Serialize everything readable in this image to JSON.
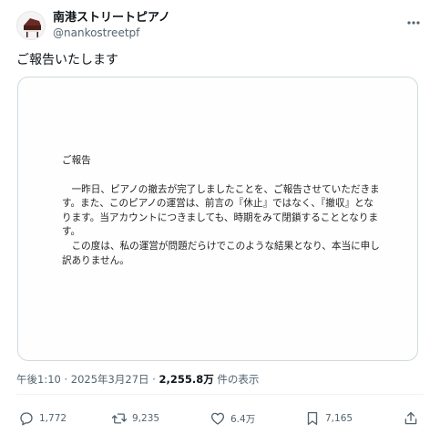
{
  "header": {
    "display_name": "南港ストリートピアノ",
    "handle": "@nankostreetpf"
  },
  "tweet": {
    "text": "ご報告いたします"
  },
  "document": {
    "heading": "ご報告",
    "paragraph1": "　一昨日、ピアノの撤去が完了しましたことを、ご報告させていただきます。また、このピアノの運営は、前言の『休止』ではなく、『撤収』となります。当アカウントにつきましても、時期をみて閉鎖することとなります。",
    "paragraph2": "　この度は、私の運営が問題だらけでこのような結果となり、本当に申し訳ありません。"
  },
  "meta": {
    "timestamp": "午後1:10 · 2025年3月27日 · ",
    "views_count": "2,255.8万",
    "views_suffix": " 件の表示"
  },
  "actions": {
    "replies": "1,772",
    "reposts": "9,235",
    "likes": "6.4万",
    "bookmarks": "7,165"
  },
  "icons": {
    "avatar": "piano-avatar",
    "more": "more-horizontal-icon",
    "reply": "reply-icon",
    "repost": "repost-icon",
    "like": "heart-icon",
    "bookmark": "bookmark-icon",
    "share": "share-icon"
  },
  "colors": {
    "text": "#0f1419",
    "secondary": "#536471",
    "border": "#cfd9de"
  }
}
